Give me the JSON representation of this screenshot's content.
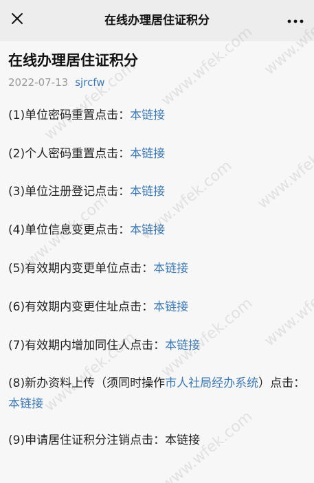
{
  "topbar": {
    "close_icon": "close-icon",
    "title": "在线办理居住证积分",
    "more_icon": "more-dots-icon"
  },
  "article": {
    "title": "在线办理居住证积分",
    "date": "2022-07-13",
    "author": "sjrcfw"
  },
  "items": [
    {
      "prefix": "(1)单位密码重置点击：",
      "link": "本链接"
    },
    {
      "prefix": "(2)个人密码重置点击：",
      "link": "本链接"
    },
    {
      "prefix": "(3)单位注册登记点击：",
      "link": "本链接"
    },
    {
      "prefix": "(4)单位信息变更点击：",
      "link": "本链接"
    },
    {
      "prefix": "(5)有效期内变更单位点击：",
      "link": "本链接"
    },
    {
      "prefix": "(6)有效期内变更住址点击：",
      "link": "本链接"
    },
    {
      "prefix": "(7)有效期内增加同住人点击：",
      "link": "本链接"
    },
    {
      "prefix": "(8)新办资料上传（须同时操作",
      "mid_link": "市人社局经办系统",
      "suffix": "）点击：",
      "link": "本链接"
    },
    {
      "text": "(9)申请居住证积分注销点击：本链接"
    }
  ],
  "watermark": "www.wfek.com",
  "colors": {
    "link": "#3e78b0",
    "background": "#f7f7f7",
    "topbar": "#ededed"
  }
}
